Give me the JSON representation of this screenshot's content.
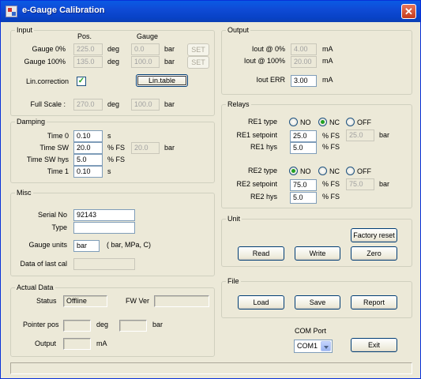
{
  "window": {
    "title": "e-Gauge Calibration",
    "close_glyph": "✕"
  },
  "input": {
    "legend": "Input",
    "col_pos": "Pos.",
    "col_gauge": "Gauge",
    "gauge0_label": "Gauge 0%",
    "gauge0_pos": "225.0",
    "gauge0_unit1": "deg",
    "gauge0_gauge": "0.0",
    "gauge0_unit2": "bar",
    "gauge0_set": "SET",
    "gauge100_label": "Gauge 100%",
    "gauge100_pos": "135.0",
    "gauge100_unit1": "deg",
    "gauge100_gauge": "100.0",
    "gauge100_unit2": "bar",
    "gauge100_set": "SET",
    "lin_label": "Lin.correction",
    "lin_checked": "✓",
    "lin_table": "Lin.table",
    "fullscale_label": "Full Scale :",
    "fullscale_pos": "270.0",
    "fullscale_unit1": "deg",
    "fullscale_gauge": "100.0",
    "fullscale_unit2": "bar"
  },
  "damping": {
    "legend": "Damping",
    "time0_label": "Time 0",
    "time0": "0.10",
    "time0_unit": "s",
    "timesw_label": "Time SW",
    "timesw": "20.0",
    "timesw_unit": "% FS",
    "timesw_bar": "20.0",
    "timesw_bar_unit": "bar",
    "timeswhys_label": "Time SW hys",
    "timeswhys": "5.0",
    "timeswhys_unit": "% FS",
    "time1_label": "Time 1",
    "time1": "0.10",
    "time1_unit": "s"
  },
  "misc": {
    "legend": "Misc",
    "serial_label": "Serial No",
    "serial": "92143",
    "type_label": "Type",
    "type": "",
    "units_label": "Gauge units",
    "units": "bar",
    "units_hint": "( bar, MPa, C)",
    "lastcal_label": "Data of last cal",
    "lastcal": ""
  },
  "actual": {
    "legend": "Actual Data",
    "status_label": "Status",
    "status": "Offline",
    "fw_label": "FW Ver",
    "fw": "",
    "pointer_label": "Pointer pos",
    "pointer_deg": "",
    "pointer_unit1": "deg",
    "pointer_bar": "",
    "pointer_unit2": "bar",
    "output_label": "Output",
    "output": "",
    "output_unit": "mA"
  },
  "output": {
    "legend": "Output",
    "iout0_label": "Iout @ 0%",
    "iout0": "4.00",
    "iout0_unit": "mA",
    "iout100_label": "Iout @ 100%",
    "iout100": "20.00",
    "iout100_unit": "mA",
    "iouterr_label": "Iout ERR",
    "iouterr": "3.00",
    "iouterr_unit": "mA"
  },
  "relays": {
    "legend": "Relays",
    "re1_type_label": "RE1 type",
    "re1_setpoint_label": "RE1 setpoint",
    "re1_setpoint": "25.0",
    "re1_setpoint_unit": "% FS",
    "re1_setpoint_bar": "25.0",
    "re1_setpoint_bar_unit": "bar",
    "re1_hys_label": "RE1 hys",
    "re1_hys": "5.0",
    "re1_hys_unit": "% FS",
    "re2_type_label": "RE2 type",
    "re2_setpoint_label": "RE2 setpoint",
    "re2_setpoint": "75.0",
    "re2_setpoint_unit": "% FS",
    "re2_setpoint_bar": "75.0",
    "re2_setpoint_bar_unit": "bar",
    "re2_hys_label": "RE2 hys",
    "re2_hys": "5.0",
    "re2_hys_unit": "% FS",
    "opt_no": "NO",
    "opt_nc": "NC",
    "opt_off": "OFF",
    "re1_selected": "NC",
    "re2_selected": "NO"
  },
  "unit": {
    "legend": "Unit",
    "factory_reset": "Factory reset",
    "read": "Read",
    "write": "Write",
    "zero": "Zero"
  },
  "file": {
    "legend": "File",
    "load": "Load",
    "save": "Save",
    "report": "Report"
  },
  "com": {
    "label": "COM Port",
    "value": "COM1",
    "exit": "Exit"
  }
}
